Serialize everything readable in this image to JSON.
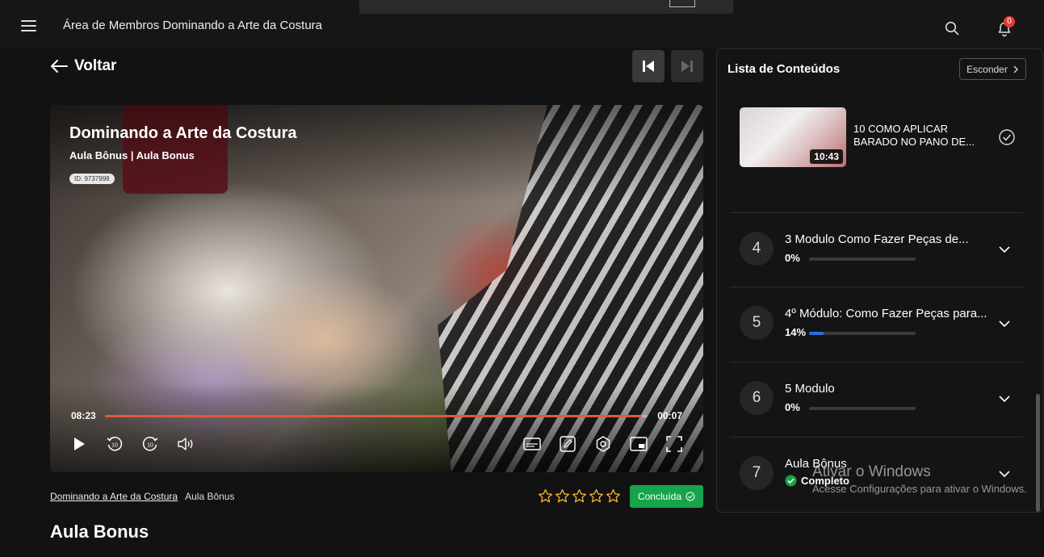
{
  "header": {
    "app_title": "Área de Membros Dominando a Arte da Costura",
    "notification_count": "0"
  },
  "nav": {
    "back_label": "Voltar"
  },
  "player": {
    "course_title": "Dominando a Arte da Costura",
    "subtitle": "Aula Bônus | Aula Bonus",
    "id_badge": "ID: 9737998",
    "current_time": "08:23",
    "remaining_time": "00:07",
    "progress_fraction": 0.99
  },
  "below_video": {
    "breadcrumb_course": "Dominando a Arte da Costura",
    "breadcrumb_module": "Aula Bônus",
    "rating_stars": 5,
    "done_label": "Concluída",
    "lesson_title": "Aula Bonus"
  },
  "sidebar": {
    "title": "Lista de Conteúdos",
    "hide_label": "Esconder",
    "lesson": {
      "title": "10 COMO APLICAR BARADO NO PANO DE...",
      "duration": "10:43"
    },
    "modules": [
      {
        "number": "4",
        "name": "3 Modulo Como Fazer Peças de...",
        "percent": "0%",
        "progress": 0
      },
      {
        "number": "5",
        "name": "4º Módulo: Como Fazer Peças para...",
        "percent": "14%",
        "progress": 0.14
      },
      {
        "number": "6",
        "name": "5 Modulo",
        "percent": "0%",
        "progress": 0
      },
      {
        "number": "7",
        "name": "Aula Bônus",
        "status": "Completo"
      }
    ]
  },
  "watermark": {
    "line1": "Ativar o Windows",
    "line2": "Acesse Configurações para ativar o Windows."
  },
  "colors": {
    "accent_green": "#17a34a",
    "progress_red": "#e05a3a",
    "module_blue": "#2e6be6",
    "badge_red": "#e53935",
    "star_gold": "#f0b429"
  }
}
